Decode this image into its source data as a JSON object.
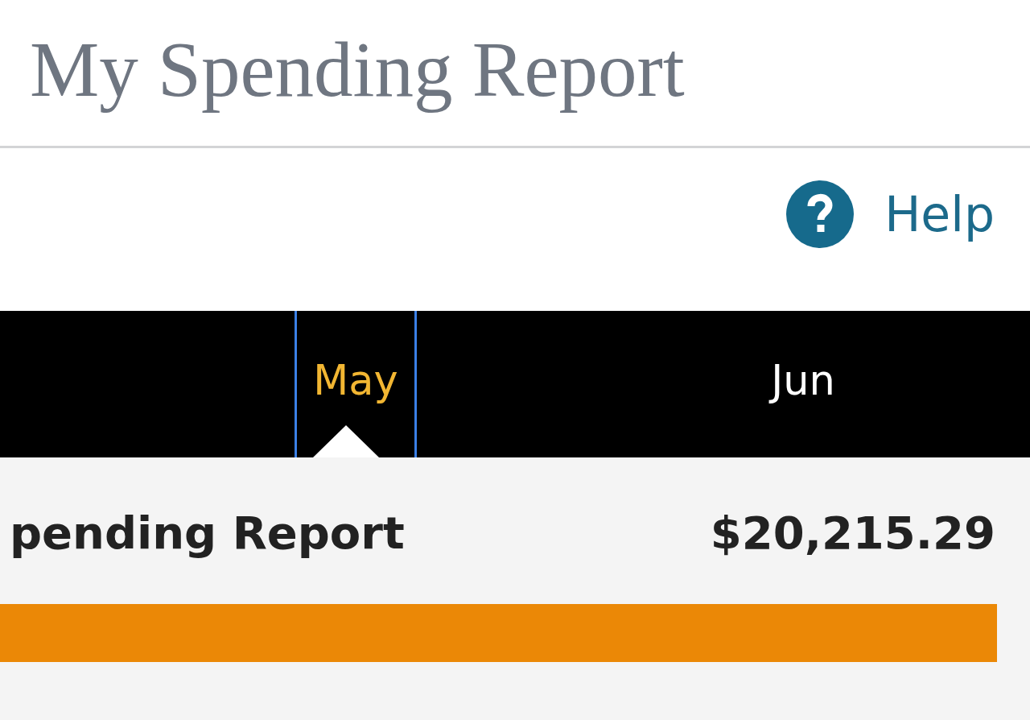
{
  "header": {
    "title": "My Spending Report"
  },
  "help": {
    "label": "Help"
  },
  "months": [
    {
      "label": "May",
      "selected": true
    },
    {
      "label": "Jun",
      "selected": false
    }
  ],
  "summary": {
    "label": "pending Report",
    "amount": "$20,215.29",
    "bar": {
      "level": 1
    }
  }
}
